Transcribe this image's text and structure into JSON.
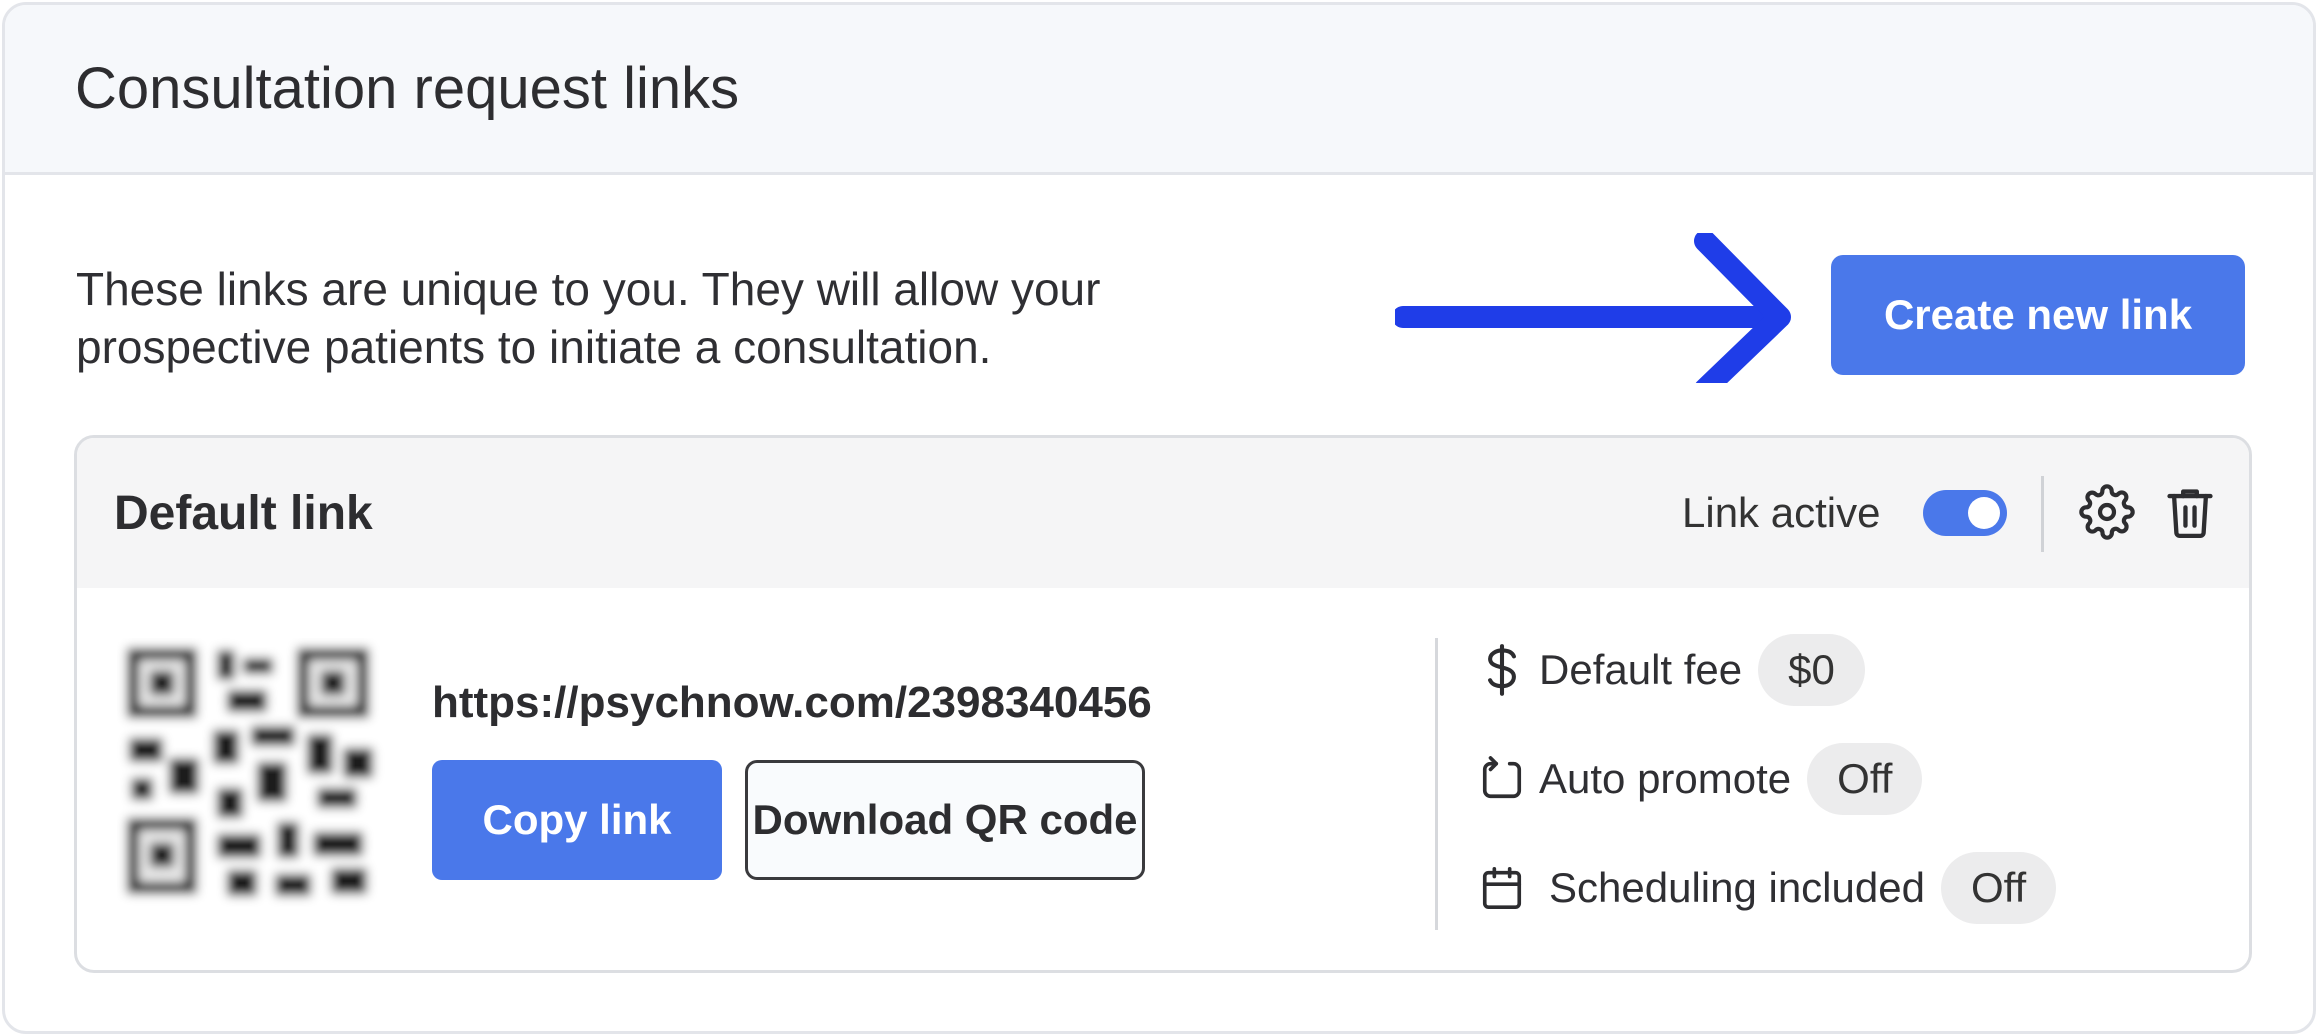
{
  "header": {
    "title": "Consultation request links"
  },
  "intro": {
    "line1": "These links are unique to you. They will allow your",
    "line2": "prospective patients to initiate a consultation."
  },
  "actions": {
    "create_label": "Create new link"
  },
  "link": {
    "name": "Default link",
    "active_label": "Link active",
    "active": true,
    "url": "https://psychnow.com/2398340456",
    "copy_label": "Copy link",
    "download_label": "Download QR code",
    "settings": [
      {
        "icon": "dollar-icon",
        "label": "Default fee",
        "value": "$0"
      },
      {
        "icon": "auto-promote-icon",
        "label": "Auto promote",
        "value": "Off"
      },
      {
        "icon": "calendar-icon",
        "label": "Scheduling included",
        "value": "Off"
      }
    ]
  },
  "colors": {
    "accent": "#4a78ea",
    "arrow": "#1f3de8",
    "header_bg": "#f6f8fb",
    "pill_bg": "#ececed"
  }
}
